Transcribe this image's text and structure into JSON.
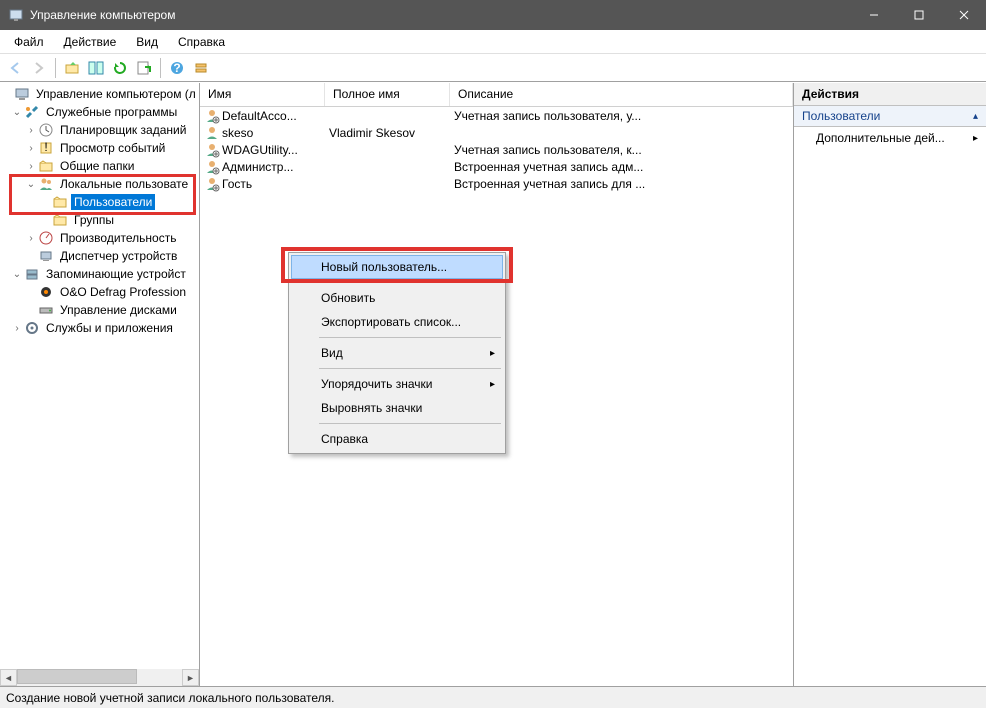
{
  "window": {
    "title": "Управление компьютером"
  },
  "menu": {
    "file": "Файл",
    "action": "Действие",
    "view": "Вид",
    "help": "Справка"
  },
  "tree": {
    "root": "Управление компьютером (л",
    "systools": "Служебные программы",
    "scheduler": "Планировщик заданий",
    "events": "Просмотр событий",
    "shared": "Общие папки",
    "localusers": "Локальные пользовате",
    "users": "Пользователи",
    "groups": "Группы",
    "perf": "Производительность",
    "devmgr": "Диспетчер устройств",
    "storage": "Запоминающие устройст",
    "defrag": "O&O Defrag Profession",
    "diskmgr": "Управление дисками",
    "services": "Службы и приложения"
  },
  "columns": {
    "name": "Имя",
    "fullname": "Полное имя",
    "desc": "Описание"
  },
  "users": [
    {
      "name": "DefaultAcco...",
      "fullname": "",
      "desc": "Учетная запись пользователя, у..."
    },
    {
      "name": "skeso",
      "fullname": "Vladimir Skesov",
      "desc": ""
    },
    {
      "name": "WDAGUtility...",
      "fullname": "",
      "desc": "Учетная запись пользователя, к..."
    },
    {
      "name": "Администр...",
      "fullname": "",
      "desc": "Встроенная учетная запись адм..."
    },
    {
      "name": "Гость",
      "fullname": "",
      "desc": "Встроенная учетная запись для ..."
    }
  ],
  "context": {
    "newuser": "Новый пользователь...",
    "refresh": "Обновить",
    "export": "Экспортировать список...",
    "view": "Вид",
    "arrange": "Упорядочить значки",
    "align": "Выровнять значки",
    "help": "Справка"
  },
  "actions": {
    "header": "Действия",
    "users": "Пользователи",
    "more": "Дополнительные дей..."
  },
  "status": "Создание новой учетной записи локального пользователя."
}
